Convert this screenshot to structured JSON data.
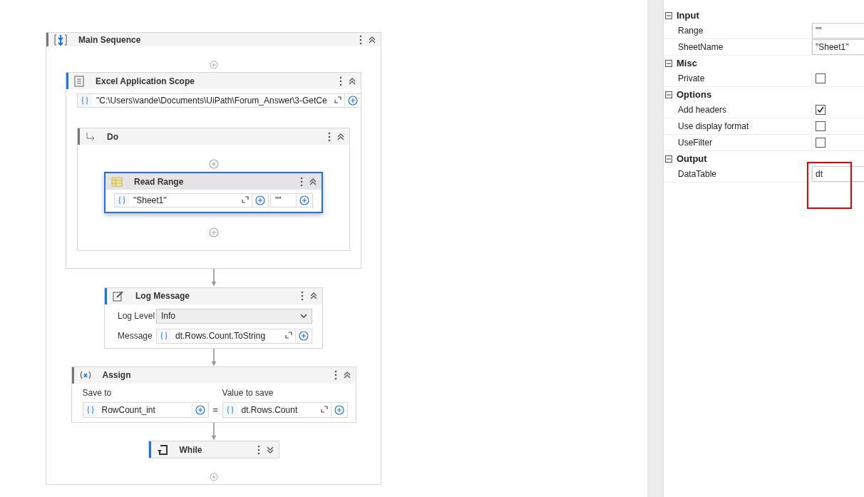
{
  "designer": {
    "title": "Main Sequence",
    "expanded": true,
    "activities": [
      {
        "kind": "excel_scope",
        "title": "Excel Application Scope",
        "selected": false,
        "expanded": true,
        "path": "\"C:\\Users\\vande\\Documents\\UiPath\\Forum_Answer\\3-GetCe",
        "body": {
          "title": "Do",
          "expanded": true,
          "activities": [
            {
              "kind": "read_range",
              "title": "Read Range",
              "selected": true,
              "expanded": true,
              "sheet": "\"Sheet1\"",
              "range": "\"\""
            }
          ]
        }
      },
      {
        "kind": "log_message",
        "title": "Log Message",
        "selected": false,
        "expanded": true,
        "level_label": "Log Level",
        "level": "Info",
        "message_label": "Message",
        "message": "dt.Rows.Count.ToString"
      },
      {
        "kind": "assign",
        "title": "Assign",
        "selected": false,
        "expanded": true,
        "to_label": "Save to",
        "to": "RowCount_int",
        "equals": "=",
        "value_label": "Value to save",
        "value": "dt.Rows.Count"
      },
      {
        "kind": "while",
        "title": "While",
        "selected": false,
        "expanded": false
      }
    ]
  },
  "properties": {
    "sections": [
      {
        "title": "Input",
        "expanded": true,
        "rows": [
          {
            "kind": "text",
            "label": "Range",
            "value": "\"\"",
            "highlighted": false
          },
          {
            "kind": "text",
            "label": "SheetName",
            "value": "\"Sheet1\"",
            "highlighted": false
          }
        ]
      },
      {
        "title": "Misc",
        "expanded": true,
        "rows": [
          {
            "kind": "checkbox",
            "label": "Private",
            "checked": false,
            "highlighted": false
          }
        ]
      },
      {
        "title": "Options",
        "expanded": true,
        "rows": [
          {
            "kind": "checkbox",
            "label": "Add headers",
            "checked": true,
            "highlighted": false
          },
          {
            "kind": "checkbox",
            "label": "Use display format",
            "checked": false,
            "highlighted": false
          },
          {
            "kind": "checkbox",
            "label": "UseFilter",
            "checked": false,
            "highlighted": false
          }
        ]
      },
      {
        "title": "Output",
        "expanded": true,
        "rows": [
          {
            "kind": "text",
            "label": "DataTable",
            "value": "dt",
            "highlighted": true
          }
        ]
      }
    ]
  }
}
